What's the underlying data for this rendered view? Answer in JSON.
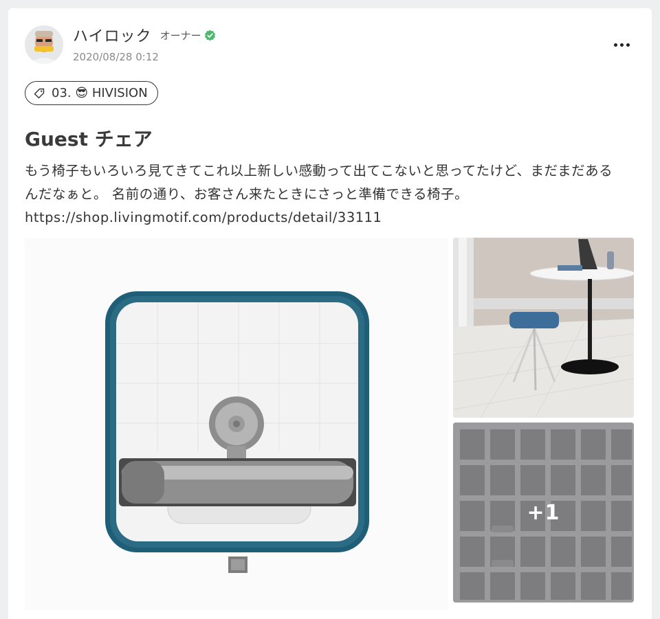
{
  "author": {
    "name": "ハイロック",
    "role_label": "オーナー",
    "timestamp": "2020/08/28 0:12"
  },
  "tag": {
    "label": "03. 😎 HIVISION"
  },
  "post": {
    "title": "Guest チェア",
    "body": "もう椅子もいろいろ見てきてこれ以上新しい感動って出てこないと思ってたけど、まだまだあるんだなぁと。 名前の通り、お客さん来たときにさっと準備できる椅子。 ",
    "link": "https://shop.livingmotif.com/products/detail/33111"
  },
  "gallery": {
    "more_count_label": "+1"
  },
  "colors": {
    "verified": "#4cb86b",
    "card_bg": "#ffffff",
    "page_bg": "#eeeff1",
    "teal_frame": "#1f5e77"
  },
  "icons": {
    "more": "more-horizontal-icon",
    "tag": "tag-icon",
    "verified": "verified-check-icon"
  }
}
